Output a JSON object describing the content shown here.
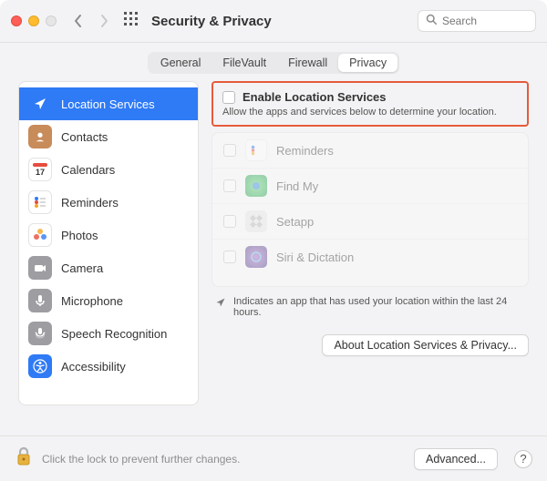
{
  "window": {
    "title": "Security & Privacy",
    "search_placeholder": "Search"
  },
  "tabs": {
    "items": [
      {
        "label": "General"
      },
      {
        "label": "FileVault"
      },
      {
        "label": "Firewall"
      },
      {
        "label": "Privacy",
        "selected": true
      }
    ]
  },
  "sidebar": {
    "items": [
      {
        "label": "Location Services",
        "icon": "location-arrow-icon",
        "selected": true,
        "bg": "#2f7af5"
      },
      {
        "label": "Contacts",
        "icon": "contacts-icon",
        "bg": "#d9a86c"
      },
      {
        "label": "Calendars",
        "icon": "calendar-icon",
        "bg": "#ffffff"
      },
      {
        "label": "Reminders",
        "icon": "reminders-icon",
        "bg": "#ffffff"
      },
      {
        "label": "Photos",
        "icon": "photos-icon",
        "bg": "#ffffff"
      },
      {
        "label": "Camera",
        "icon": "camera-icon",
        "bg": "#9d9da2"
      },
      {
        "label": "Microphone",
        "icon": "microphone-icon",
        "bg": "#9d9da2"
      },
      {
        "label": "Speech Recognition",
        "icon": "speech-icon",
        "bg": "#9d9da2"
      },
      {
        "label": "Accessibility",
        "icon": "accessibility-icon",
        "bg": "#2f7af5"
      }
    ]
  },
  "main": {
    "enable_label": "Enable Location Services",
    "enable_desc": "Allow the apps and services below to determine your location.",
    "enable_checked": false,
    "apps": [
      {
        "label": "Reminders",
        "icon": "reminders-icon"
      },
      {
        "label": "Find My",
        "icon": "findmy-icon"
      },
      {
        "label": "Setapp",
        "icon": "setapp-icon"
      },
      {
        "label": "Siri & Dictation",
        "icon": "siri-icon"
      }
    ],
    "note": "Indicates an app that has used your location within the last 24 hours.",
    "about_label": "About Location Services & Privacy..."
  },
  "footer": {
    "lock_text": "Click the lock to prevent further changes.",
    "advanced_label": "Advanced...",
    "help_label": "?"
  }
}
